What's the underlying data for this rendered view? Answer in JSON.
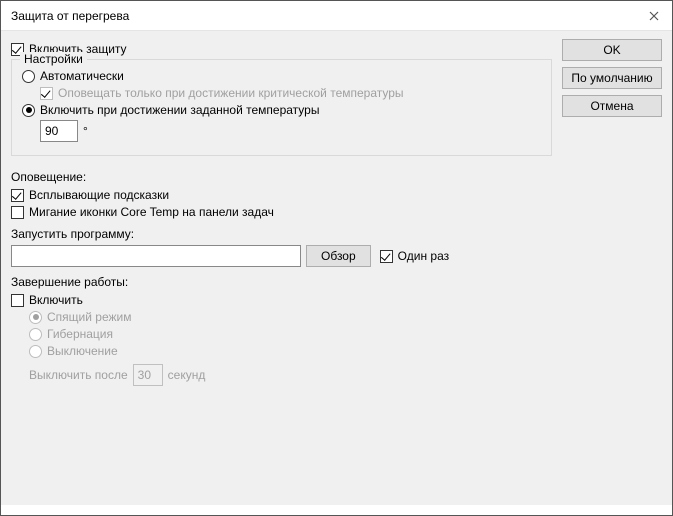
{
  "window": {
    "title": "Защита от перегрева"
  },
  "main": {
    "enable_protection": "Включить защиту",
    "settings_legend": "Настройки",
    "auto": "Автоматически",
    "notify_critical": "Оповещать только при достижении критической температуры",
    "enable_at_temp": "Включить при достижении заданной температуры",
    "temp_value": "90",
    "degree": "°",
    "notification_label": "Оповещение:",
    "popup_hints": "Всплывающие подсказки",
    "flash_icon": "Мигание иконки Core Temp на панели задач",
    "run_program_label": "Запустить программу:",
    "program_path": "",
    "browse": "Обзор",
    "once": "Один раз",
    "shutdown_label": "Завершение работы:",
    "enable_shutdown": "Включить",
    "sleep": "Спящий режим",
    "hibernate": "Гибернация",
    "poweroff": "Выключение",
    "turnoff_after": "Выключить после",
    "seconds_value": "30",
    "seconds": "секунд"
  },
  "buttons": {
    "ok": "OK",
    "default": "По умолчанию",
    "cancel": "Отмена"
  }
}
